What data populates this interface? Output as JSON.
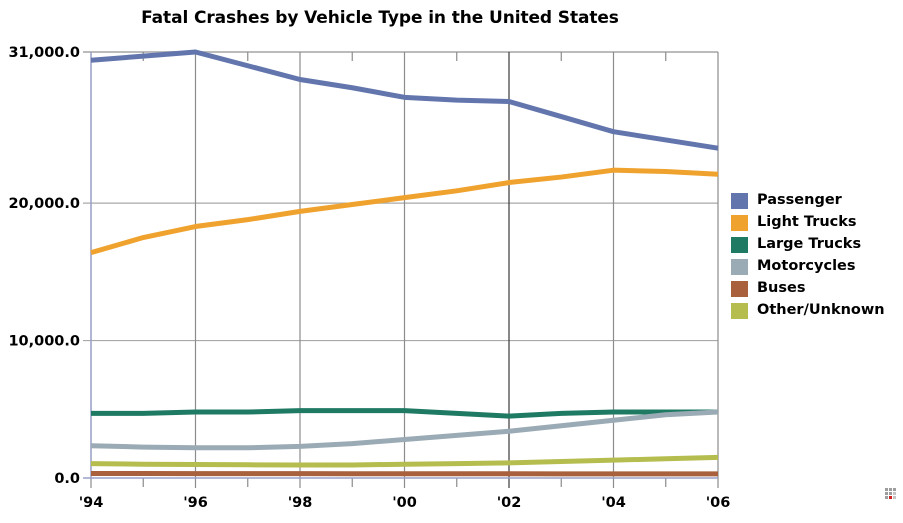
{
  "chart_data": {
    "type": "line",
    "title": "Fatal Crashes by Vehicle Type in the United States",
    "xlabel": "",
    "ylabel": "",
    "grid": true,
    "legend_position": "right",
    "x": [
      1994,
      1995,
      1996,
      1997,
      1998,
      1999,
      2000,
      2001,
      2002,
      2003,
      2004,
      2005,
      2006
    ],
    "categories": [
      "'94",
      "'95",
      "'96",
      "'97",
      "'98",
      "'99",
      "'00",
      "'01",
      "'02",
      "'03",
      "'04",
      "'05",
      "'06"
    ],
    "xtick_labels": [
      "'94",
      "'96",
      "'98",
      "'00",
      "'02",
      "'04",
      "'06"
    ],
    "ytick_labels": [
      "0.0",
      "10,000.0",
      "20,000.0",
      "31,000.0"
    ],
    "ytick_values": [
      0,
      10000,
      20000,
      31000
    ],
    "xlim": [
      1994,
      2006
    ],
    "ylim": [
      0,
      31000
    ],
    "series": [
      {
        "name": "Passenger",
        "color": "#6375ad",
        "values": [
          30400,
          30700,
          31000,
          30000,
          29000,
          28400,
          27700,
          27500,
          27400,
          26300,
          25200,
          24600,
          24000
        ]
      },
      {
        "name": "Light Trucks",
        "color": "#f0a22e",
        "values": [
          16400,
          17500,
          18300,
          18800,
          19400,
          19900,
          20400,
          20900,
          21500,
          21900,
          22400,
          22300,
          22100
        ]
      },
      {
        "name": "Large Trucks",
        "color": "#1f7a63",
        "values": [
          4700,
          4700,
          4800,
          4800,
          4900,
          4900,
          4900,
          4700,
          4500,
          4700,
          4800,
          4800,
          4800
        ]
      },
      {
        "name": "Motorcycles",
        "color": "#9aabb5",
        "values": [
          2350,
          2250,
          2200,
          2200,
          2300,
          2500,
          2800,
          3100,
          3400,
          3800,
          4200,
          4600,
          4800
        ]
      },
      {
        "name": "Buses",
        "color": "#a8613c",
        "values": [
          330,
          330,
          320,
          320,
          320,
          310,
          310,
          310,
          310,
          300,
          300,
          300,
          300
        ]
      },
      {
        "name": "Other/Unknown",
        "color": "#b5bd4e",
        "values": [
          1050,
          1000,
          980,
          960,
          950,
          950,
          1000,
          1050,
          1100,
          1200,
          1300,
          1400,
          1500
        ]
      }
    ]
  },
  "legend": {
    "items": [
      {
        "label": "Passenger",
        "color": "#6375ad"
      },
      {
        "label": "Light Trucks",
        "color": "#f0a22e"
      },
      {
        "label": "Large Trucks",
        "color": "#1f7a63"
      },
      {
        "label": "Motorcycles",
        "color": "#9aabb5"
      },
      {
        "label": "Buses",
        "color": "#a8613c"
      },
      {
        "label": "Other/Unknown",
        "color": "#b5bd4e"
      }
    ]
  },
  "style": {
    "gridline_color": "#808080",
    "axis_color": "#9aa0c8",
    "top_border_color": "#bbbbbb",
    "background": "#ffffff"
  },
  "window": {
    "resize_grip": "resize-grip-icon"
  }
}
